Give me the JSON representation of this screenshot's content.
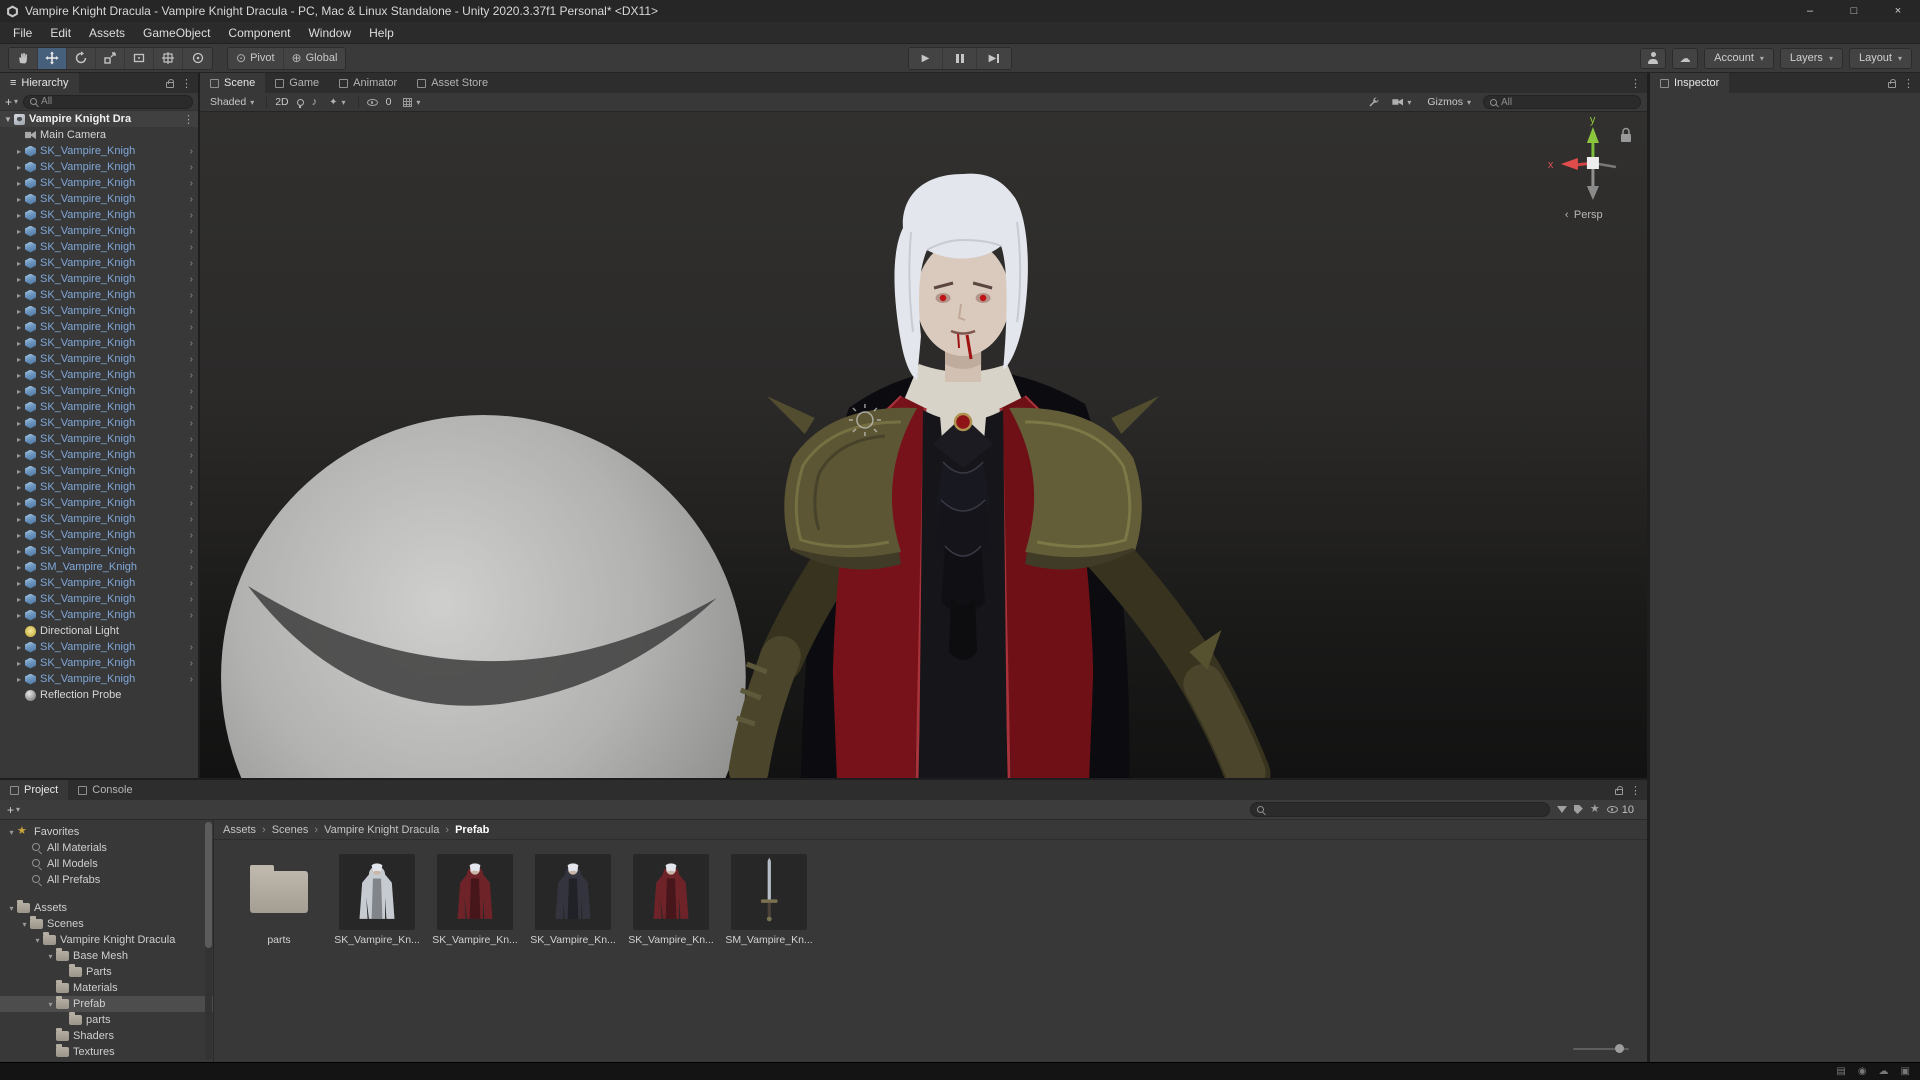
{
  "window": {
    "title": "Vampire Knight Dracula - Vampire Knight Dracula - PC, Mac & Linux Standalone - Unity 2020.3.37f1 Personal* <DX11>",
    "minimize": "–",
    "maximize": "□",
    "close": "×"
  },
  "glyphs": {
    "caret": "▾",
    "kebab": "⋮",
    "plus": "+",
    "nav": "›",
    "crumb_sep": "›",
    "play": "▶",
    "collapse": "▼",
    "note": "♪",
    "sparkle": "✦",
    "cloud": "☁",
    "pivot_icon": "⊙",
    "globe_icon": "⊕",
    "persp_arrow": "‹",
    "star": "★",
    "menu_icon": "≡"
  },
  "menubar": {
    "items": [
      {
        "label": "File"
      },
      {
        "label": "Edit"
      },
      {
        "label": "Assets"
      },
      {
        "label": "GameObject"
      },
      {
        "label": "Component"
      },
      {
        "label": "Window"
      },
      {
        "label": "Help"
      }
    ]
  },
  "toolbar": {
    "tools": [
      {
        "name": "hand"
      },
      {
        "name": "move",
        "selected": true
      },
      {
        "name": "rotate"
      },
      {
        "name": "scale"
      },
      {
        "name": "rect"
      },
      {
        "name": "transform"
      },
      {
        "name": "custom"
      }
    ],
    "pivot": "Pivot",
    "global": "Global",
    "account": "Account",
    "layers": "Layers",
    "layout": "Layout"
  },
  "hierarchy": {
    "title": "Hierarchy",
    "search_text": "All",
    "scene": {
      "name": "Vampire Knight Dra"
    },
    "items": [
      {
        "label": "Main Camera",
        "type": "camera"
      },
      {
        "label": "SK_Vampire_Knigh",
        "type": "prefab"
      },
      {
        "label": "SK_Vampire_Knigh",
        "type": "prefab"
      },
      {
        "label": "SK_Vampire_Knigh",
        "type": "prefab"
      },
      {
        "label": "SK_Vampire_Knigh",
        "type": "prefab"
      },
      {
        "label": "SK_Vampire_Knigh",
        "type": "prefab"
      },
      {
        "label": "SK_Vampire_Knigh",
        "type": "prefab"
      },
      {
        "label": "SK_Vampire_Knigh",
        "type": "prefab"
      },
      {
        "label": "SK_Vampire_Knigh",
        "type": "prefab"
      },
      {
        "label": "SK_Vampire_Knigh",
        "type": "prefab"
      },
      {
        "label": "SK_Vampire_Knigh",
        "type": "prefab"
      },
      {
        "label": "SK_Vampire_Knigh",
        "type": "prefab"
      },
      {
        "label": "SK_Vampire_Knigh",
        "type": "prefab"
      },
      {
        "label": "SK_Vampire_Knigh",
        "type": "prefab"
      },
      {
        "label": "SK_Vampire_Knigh",
        "type": "prefab"
      },
      {
        "label": "SK_Vampire_Knigh",
        "type": "prefab"
      },
      {
        "label": "SK_Vampire_Knigh",
        "type": "prefab"
      },
      {
        "label": "SK_Vampire_Knigh",
        "type": "prefab"
      },
      {
        "label": "SK_Vampire_Knigh",
        "type": "prefab"
      },
      {
        "label": "SK_Vampire_Knigh",
        "type": "prefab"
      },
      {
        "label": "SK_Vampire_Knigh",
        "type": "prefab"
      },
      {
        "label": "SK_Vampire_Knigh",
        "type": "prefab"
      },
      {
        "label": "SK_Vampire_Knigh",
        "type": "prefab"
      },
      {
        "label": "SK_Vampire_Knigh",
        "type": "prefab"
      },
      {
        "label": "SK_Vampire_Knigh",
        "type": "prefab"
      },
      {
        "label": "SK_Vampire_Knigh",
        "type": "prefab"
      },
      {
        "label": "SK_Vampire_Knigh",
        "type": "prefab"
      },
      {
        "label": "SM_Vampire_Knigh",
        "type": "prefab"
      },
      {
        "label": "SK_Vampire_Knigh",
        "type": "prefab"
      },
      {
        "label": "SK_Vampire_Knigh",
        "type": "prefab"
      },
      {
        "label": "SK_Vampire_Knigh",
        "type": "prefab"
      },
      {
        "label": "Directional Light",
        "type": "light"
      },
      {
        "label": "SK_Vampire_Knigh",
        "type": "prefab"
      },
      {
        "label": "SK_Vampire_Knigh",
        "type": "prefab"
      },
      {
        "label": "SK_Vampire_Knigh",
        "type": "prefab"
      },
      {
        "label": "Reflection Probe",
        "type": "probe"
      }
    ]
  },
  "scene_view": {
    "tabs": [
      {
        "label": "Scene",
        "active": true
      },
      {
        "label": "Game"
      },
      {
        "label": "Animator"
      },
      {
        "label": "Asset Store"
      }
    ],
    "draw_mode": "Shaded",
    "toggle_2d": "2D",
    "hidden_count": "0",
    "gizmos": "Gizmos",
    "search_text": "All",
    "gizmo": {
      "axis_x": "x",
      "axis_y": "y",
      "projection": "Persp"
    }
  },
  "inspector": {
    "title": "Inspector"
  },
  "project": {
    "tabs": [
      {
        "label": "Project",
        "active": true
      },
      {
        "label": "Console"
      }
    ],
    "hidden_count": "10",
    "tree": [
      {
        "label": "Favorites",
        "icon": "star",
        "level": 0,
        "expanded": true
      },
      {
        "label": "All Materials",
        "icon": "search",
        "level": 1
      },
      {
        "label": "All Models",
        "icon": "search",
        "level": 1
      },
      {
        "label": "All Prefabs",
        "icon": "search",
        "level": 1
      },
      {
        "label": "Assets",
        "icon": "folder",
        "level": 0,
        "expanded": true,
        "gap": true
      },
      {
        "label": "Scenes",
        "icon": "folder",
        "level": 1,
        "expanded": true
      },
      {
        "label": "Vampire Knight Dracula",
        "icon": "folder",
        "level": 2,
        "expanded": true
      },
      {
        "label": "Base Mesh",
        "icon": "folder",
        "level": 3,
        "expanded": true
      },
      {
        "label": "Parts",
        "icon": "folder",
        "level": 4
      },
      {
        "label": "Materials",
        "icon": "folder",
        "level": 3
      },
      {
        "label": "Prefab",
        "icon": "folder",
        "level": 3,
        "expanded": true,
        "selected": true
      },
      {
        "label": "parts",
        "icon": "folder",
        "level": 4
      },
      {
        "label": "Shaders",
        "icon": "folder",
        "level": 3
      },
      {
        "label": "Textures",
        "icon": "folder",
        "level": 3
      }
    ],
    "breadcrumb": [
      {
        "label": "Assets"
      },
      {
        "label": "Scenes"
      },
      {
        "label": "Vampire Knight Dracula"
      },
      {
        "label": "Prefab",
        "current": true
      }
    ],
    "items": [
      {
        "label": "parts",
        "type": "folder"
      },
      {
        "label": "SK_Vampire_Kn...",
        "type": "char-white"
      },
      {
        "label": "SK_Vampire_Kn...",
        "type": "char-red"
      },
      {
        "label": "SK_Vampire_Kn...",
        "type": "char-dark"
      },
      {
        "label": "SK_Vampire_Kn...",
        "type": "char-red"
      },
      {
        "label": "SM_Vampire_Kn...",
        "type": "sword"
      }
    ]
  },
  "colors": {
    "prefab_text": "#7fa8d9",
    "selection_row": "#4d4d4d",
    "tool_selected": "#46607c",
    "axis_green": "#8cc63f",
    "axis_red": "#e04c4c",
    "panel_bg": "#383838",
    "strip_bg": "#2d2d2d"
  }
}
